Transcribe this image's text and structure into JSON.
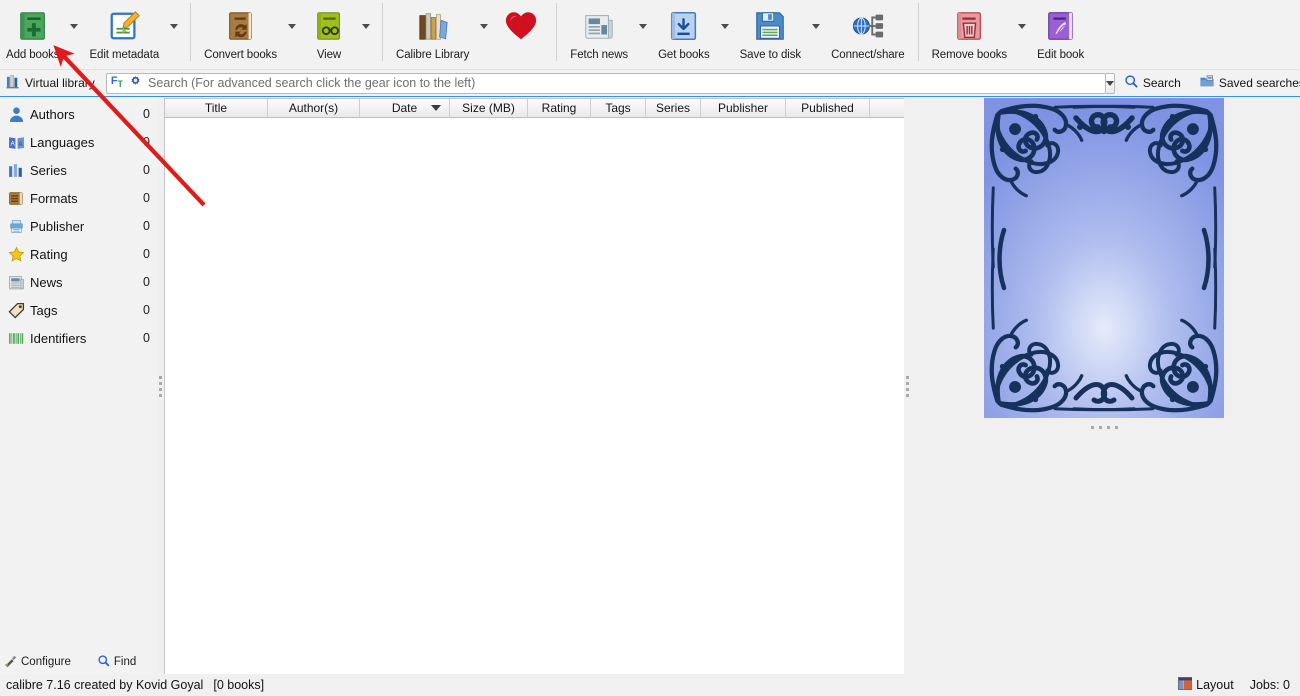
{
  "app": {
    "name": "calibre",
    "version": "7.16",
    "accent_blue": "#3b8ee8",
    "annotation_color": "#e01b1b"
  },
  "toolbar": {
    "items": [
      {
        "label": "Add books",
        "icon": "add-books-icon",
        "has_menu": true,
        "sep_after": false
      },
      {
        "label": "Edit metadata",
        "icon": "edit-metadata-icon",
        "has_menu": true,
        "sep_after": true
      },
      {
        "label": "Convert books",
        "icon": "convert-books-icon",
        "has_menu": true,
        "sep_after": false
      },
      {
        "label": "View",
        "icon": "view-icon",
        "has_menu": true,
        "sep_after": true
      },
      {
        "label": "Calibre Library",
        "icon": "calibre-library-icon",
        "has_menu": true,
        "sep_after": false
      },
      {
        "label": "",
        "icon": "heart-icon",
        "has_menu": false,
        "sep_after": true
      },
      {
        "label": "Fetch news",
        "icon": "fetch-news-icon",
        "has_menu": true,
        "sep_after": false
      },
      {
        "label": "Get books",
        "icon": "get-books-icon",
        "has_menu": true,
        "sep_after": false
      },
      {
        "label": "Save to disk",
        "icon": "save-to-disk-icon",
        "has_menu": true,
        "sep_after": false
      },
      {
        "label": "Connect/share",
        "icon": "connect-share-icon",
        "has_menu": false,
        "sep_after": true
      },
      {
        "label": "Remove books",
        "icon": "remove-books-icon",
        "has_menu": true,
        "sep_after": false
      },
      {
        "label": "Edit book",
        "icon": "edit-book-icon",
        "has_menu": false,
        "sep_after": false
      }
    ]
  },
  "search": {
    "virtual_library_label": "Virtual library",
    "field_icon": "full-text-search-icon",
    "gear_icon": "gear-icon",
    "placeholder": "Search (For advanced search click the gear icon to the left)",
    "value": "",
    "search_button_label": "Search",
    "saved_searches_label": "Saved searches"
  },
  "sidebar": {
    "items": [
      {
        "label": "Authors",
        "count": "0",
        "icon": "author-icon"
      },
      {
        "label": "Languages",
        "count": "0",
        "icon": "languages-icon"
      },
      {
        "label": "Series",
        "count": "0",
        "icon": "series-icon"
      },
      {
        "label": "Formats",
        "count": "0",
        "icon": "formats-icon"
      },
      {
        "label": "Publisher",
        "count": "0",
        "icon": "publisher-icon"
      },
      {
        "label": "Rating",
        "count": "0",
        "icon": "rating-star-icon"
      },
      {
        "label": "News",
        "count": "0",
        "icon": "news-icon"
      },
      {
        "label": "Tags",
        "count": "0",
        "icon": "tags-icon"
      },
      {
        "label": "Identifiers",
        "count": "0",
        "icon": "identifiers-icon"
      }
    ],
    "configure_label": "Configure",
    "find_label": "Find"
  },
  "book_list": {
    "columns": [
      {
        "label": "Title",
        "width": 103,
        "sorted": false
      },
      {
        "label": "Author(s)",
        "width": 92,
        "sorted": false
      },
      {
        "label": "Date",
        "width": 90,
        "sorted": true
      },
      {
        "label": "Size (MB)",
        "width": 78,
        "sorted": false
      },
      {
        "label": "Rating",
        "width": 63,
        "sorted": false
      },
      {
        "label": "Tags",
        "width": 55,
        "sorted": false
      },
      {
        "label": "Series",
        "width": 55,
        "sorted": false
      },
      {
        "label": "Publisher",
        "width": 85,
        "sorted": false
      },
      {
        "label": "Published",
        "width": 84,
        "sorted": false
      }
    ],
    "rows": [],
    "empty": true
  },
  "cover": {
    "name": "default-book-cover",
    "description": "Decorative blue ornamental book cover placeholder"
  },
  "status_bar": {
    "credit": "calibre 7.16 created by Kovid Goyal",
    "book_count": "[0 books]",
    "layout_label": "Layout",
    "jobs_label": "Jobs: 0"
  },
  "annotation": {
    "type": "arrow",
    "points_to": "Add books",
    "color": "#e01b1b"
  }
}
